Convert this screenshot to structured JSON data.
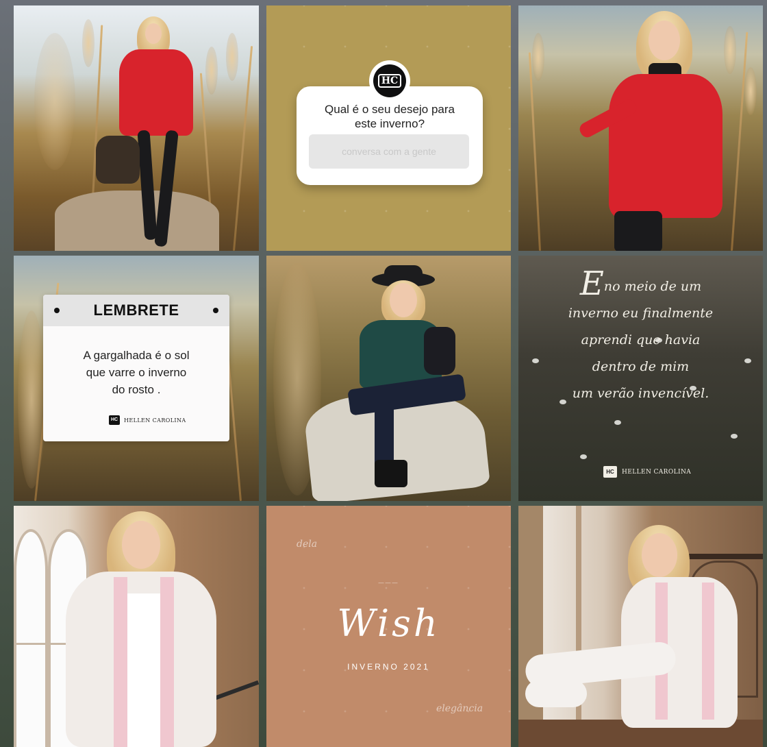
{
  "tiles": {
    "question": {
      "logo_mark": "HC",
      "question_line1": "Qual é o seu desejo para",
      "question_line2": "este inverno?",
      "answer_value": "conversa com a gente"
    },
    "reminder": {
      "title": "LEMBRETE",
      "body_line1": "A gargalhada é o sol",
      "body_line2": "que varre o inverno",
      "body_line3": "do rosto .",
      "brand_mark": "HC",
      "brand_name": "HELLEN CAROLINA"
    },
    "poem": {
      "cap": "E",
      "line1": "no meio de um",
      "line2": "inverno eu finalmente",
      "line3": "aprendi que havia",
      "line4": "dentro de mim",
      "line5": "um verão invencível.",
      "brand_mark": "HC",
      "brand_name": "HELLEN CAROLINA"
    },
    "wish": {
      "corner_top": "dela",
      "center_small": "———",
      "title": "Wish",
      "subtitle": "INVERNO 2021",
      "corner_bottom": "elegância"
    }
  },
  "colors": {
    "olive_card": "#b39b56",
    "terracotta_card": "#c18b6a",
    "red_coat": "#d8232c",
    "pink_coat": "#f0c7cf"
  }
}
